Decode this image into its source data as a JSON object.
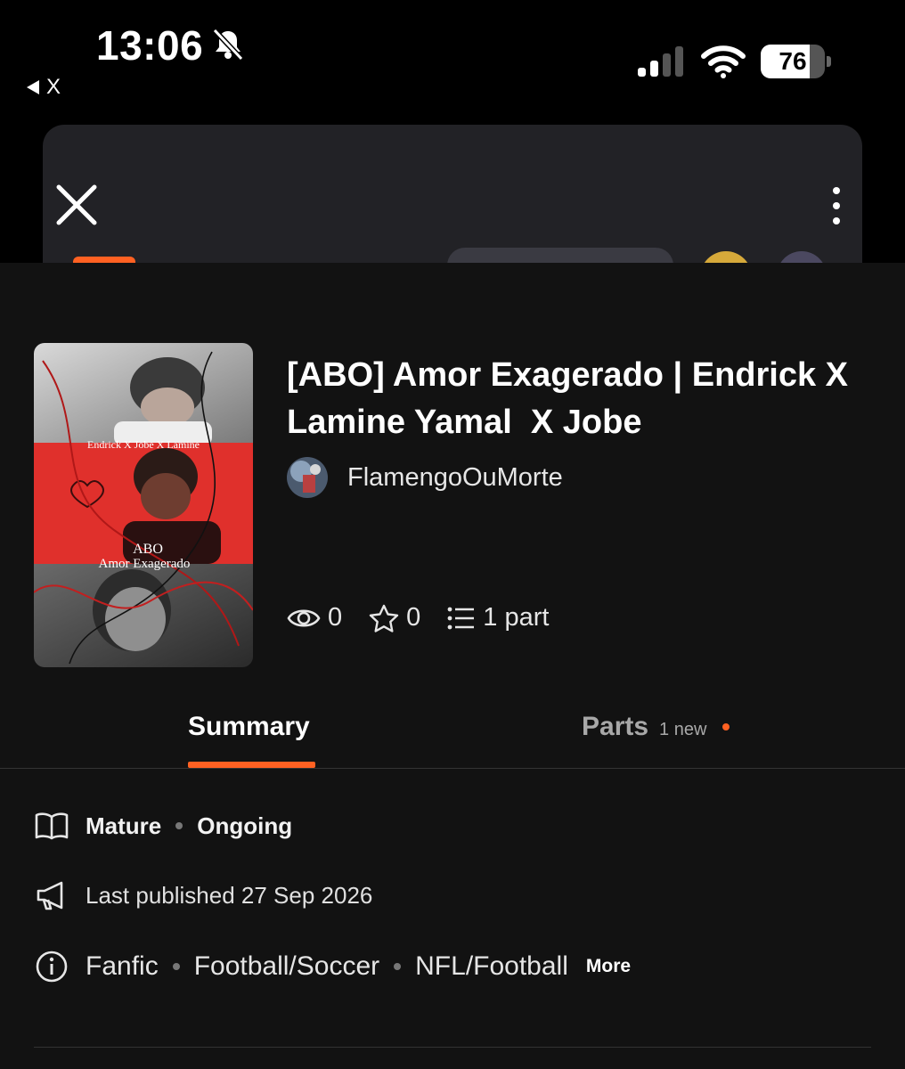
{
  "status_bar": {
    "time": "13:06",
    "back_app_label": "X",
    "battery_level": "76",
    "battery_fraction": 0.76,
    "silent_mode": true,
    "signal_bars_active": 2,
    "signal_bars_total": 4
  },
  "colors": {
    "accent": "#ff6122",
    "sheet_bg": "#121212",
    "card_bg": "#222226"
  },
  "header": {
    "close_icon": "close-icon",
    "menu_icon": "more-vertical-icon"
  },
  "story": {
    "title": "[ABO] Amor Exagerado | Endrick X\nLamine Yamal  X Jobe",
    "author": "FlamengoOuMorte",
    "cover": {
      "caption_top": "Endrick X Jobe X Lamine",
      "caption_title_1": "ABO",
      "caption_title_2": "Amor Exagerado"
    },
    "stats": {
      "reads": "0",
      "votes": "0",
      "parts": "1 part"
    }
  },
  "tabs": {
    "summary": "Summary",
    "parts": "Parts",
    "parts_badge": "1 new"
  },
  "details": {
    "rating": "Mature",
    "status": "Ongoing",
    "last_published": "Last published 27 Sep 2026",
    "tags": [
      "Fanfic",
      "Football/Soccer",
      "NFL/Football"
    ],
    "more_label": "More"
  }
}
